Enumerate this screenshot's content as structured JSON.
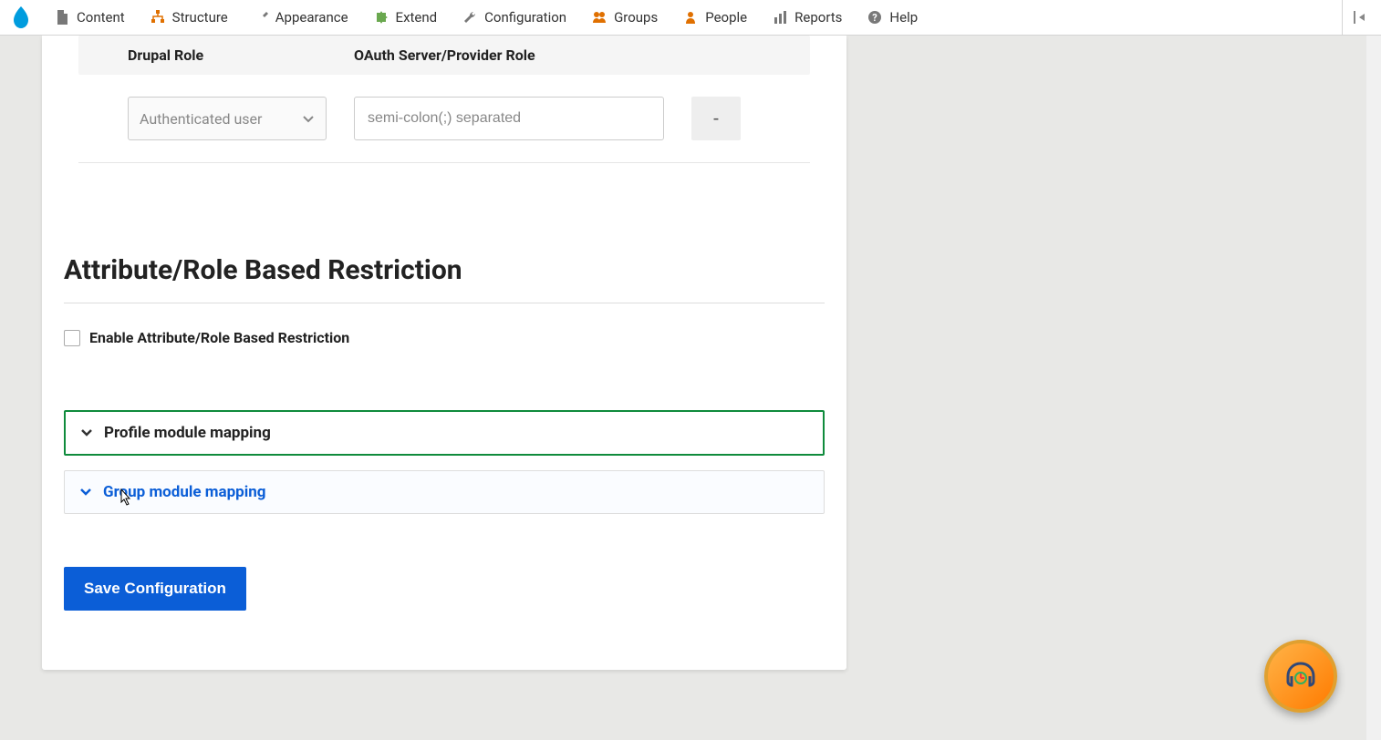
{
  "toolbar": {
    "items": [
      {
        "label": "Content",
        "icon": "file-icon"
      },
      {
        "label": "Structure",
        "icon": "sitemap-icon"
      },
      {
        "label": "Appearance",
        "icon": "brush-icon"
      },
      {
        "label": "Extend",
        "icon": "puzzle-icon"
      },
      {
        "label": "Configuration",
        "icon": "wrench-icon"
      },
      {
        "label": "Groups",
        "icon": "groups-icon"
      },
      {
        "label": "People",
        "icon": "people-icon"
      },
      {
        "label": "Reports",
        "icon": "chart-icon"
      },
      {
        "label": "Help",
        "icon": "help-icon"
      }
    ]
  },
  "roleMapping": {
    "headers": {
      "drupal": "Drupal Role",
      "oauth": "OAuth Server/Provider Role"
    },
    "row": {
      "selectValue": "Authenticated user",
      "inputPlaceholder": "semi-colon(;) separated",
      "removeLabel": "-"
    }
  },
  "restriction": {
    "heading": "Attribute/Role Based Restriction",
    "checkboxLabel": "Enable Attribute/Role Based Restriction"
  },
  "accordions": {
    "profile": "Profile module mapping",
    "group": "Group module mapping"
  },
  "saveButton": "Save Configuration"
}
